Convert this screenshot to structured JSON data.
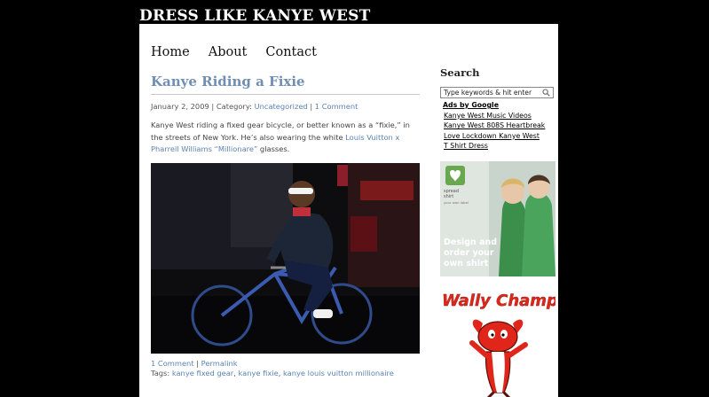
{
  "site": {
    "title": "DRESS LIKE KANYE WEST"
  },
  "nav": {
    "items": [
      "Home",
      "About",
      "Contact"
    ]
  },
  "post": {
    "title": "Kanye Riding a Fixie",
    "date": "January 2, 2009",
    "category_prefix": "| Category:",
    "category": "Uncategorized",
    "comments_link": "1 Comment",
    "body_text": "Kanye West riding a fixed gear bicycle, or better known as a “fixie,” in the streets of New York. He’s also wearing the white ",
    "body_link": "Louis Vuitton x Pharrell Williams “Millionare”",
    "body_tail": " glasses.",
    "footer_comments": "1 Comment",
    "footer_permalink": "Permalink",
    "tags_label": "Tags:",
    "tags": [
      "kanye fixed gear",
      "kanye fixie",
      "kanye louis vuitton millionaire"
    ]
  },
  "sidebar": {
    "search_heading": "Search",
    "search_placeholder": "Type keywords & hit enter",
    "ads_label": "Ads by Google",
    "ads": [
      "Kanye West Music Videos",
      "Kanye West 808S Heartbreak",
      "Love Lockdown Kanye West",
      "T Shirt Dress"
    ],
    "spreadshirt": {
      "logo_line1": "spread",
      "logo_line2": "shirt",
      "tagline": "your own label",
      "headline": "Design and order your own shirt"
    },
    "wally": {
      "title": "Wally Champ"
    }
  },
  "colors": {
    "link": "#5a82b5",
    "title": "#6f8fb4",
    "spread_green": "#6aa84f",
    "wally_red": "#e0261b"
  }
}
